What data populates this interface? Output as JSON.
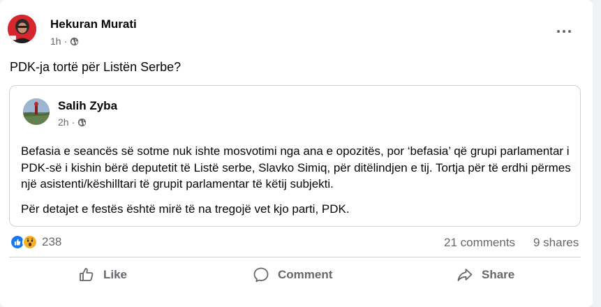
{
  "post": {
    "author": "Hekuran Murati",
    "time": "1h",
    "separator": "·",
    "text": "PDK-ja tortë për Listën Serbe?"
  },
  "shared_post": {
    "author": "Salih Zyba",
    "time": "2h",
    "separator": "·",
    "paragraph_1": "Befasia e seancës së sotme nuk ishte mosvotimi nga ana e opozitës, por ‘befasia’ që grupi parlamentar i PDK-së i kishin bërë deputetit të Listë serbe, Slavko Simiq, për ditëlindjen e tij. Tortja për të erdhi përmes një asistenti/këshilltari të grupit parlamentar të këtij subjekti.",
    "paragraph_2": "Për detajet e festës është mirë të na tregojë vet kjo parti, PDK."
  },
  "stats": {
    "reaction_count": "238",
    "comments": "21 comments",
    "shares": "9 shares"
  },
  "actions": {
    "like": "Like",
    "comment": "Comment",
    "share": "Share"
  },
  "icons": {
    "reactions": [
      "like-reaction-icon",
      "wow-reaction-icon"
    ],
    "privacy": "globe-icon",
    "menu": "more-options-icon"
  },
  "colors": {
    "like_blue": "#1877f2",
    "wow_yellow": "#f7b125",
    "muted_text": "#65676b"
  }
}
